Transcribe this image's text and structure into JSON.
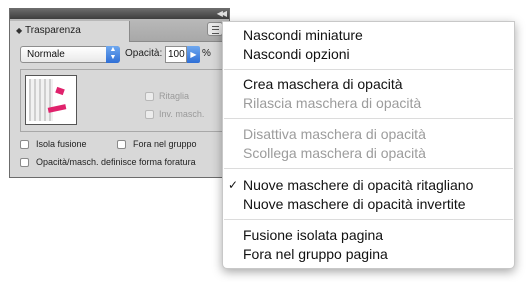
{
  "panel": {
    "tab_label": "Trasparenza",
    "blend_mode": "Normale",
    "opacity_label": "Opacità:",
    "opacity_value": "100",
    "percent_sign": "%",
    "checkboxes": {
      "clip": "Ritaglia",
      "invert_mask": "Inv. masch.",
      "isolate_blending": "Isola fusione",
      "knockout_group": "Fora nel gruppo",
      "opacity_mask_knockout": "Opacità/masch. definisce forma foratura"
    }
  },
  "menu": {
    "items": [
      {
        "label": "Nascondi miniature",
        "enabled": true,
        "checked": false
      },
      {
        "label": "Nascondi opzioni",
        "enabled": true,
        "checked": false
      },
      {
        "label": "Crea maschera di opacità",
        "enabled": true,
        "checked": false
      },
      {
        "label": "Rilascia maschera di opacità",
        "enabled": false,
        "checked": false
      },
      {
        "label": "Disattiva maschera di opacità",
        "enabled": false,
        "checked": false
      },
      {
        "label": "Scollega maschera di opacità",
        "enabled": false,
        "checked": false
      },
      {
        "label": "Nuove maschere di opacità ritagliano",
        "enabled": true,
        "checked": true
      },
      {
        "label": "Nuove maschere di opacità invertite",
        "enabled": true,
        "checked": false
      },
      {
        "label": "Fusione isolata pagina",
        "enabled": true,
        "checked": false
      },
      {
        "label": "Fora nel gruppo pagina",
        "enabled": true,
        "checked": false
      }
    ],
    "check_glyph": "✓"
  }
}
